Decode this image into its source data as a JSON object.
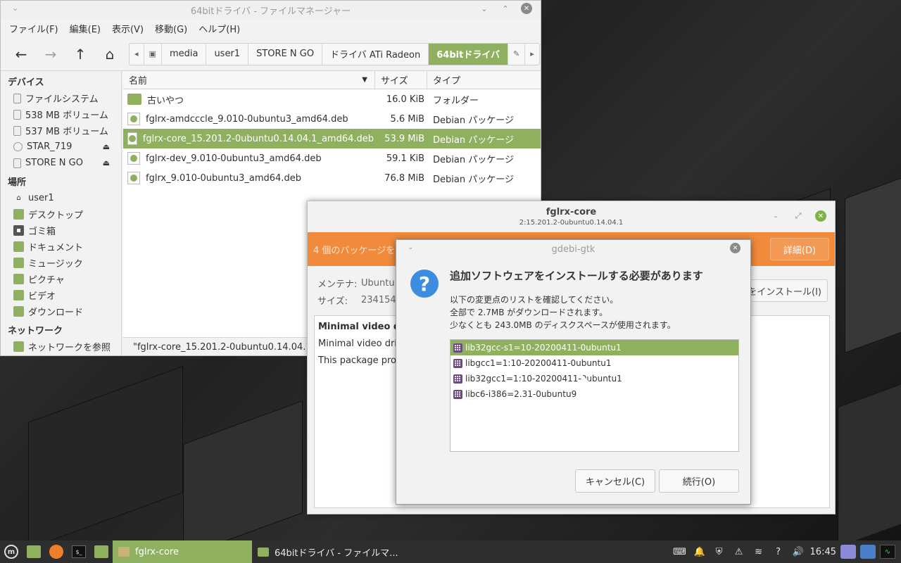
{
  "file_manager": {
    "title": "64bitドライバ - ファイルマネージャー",
    "menu": [
      "ファイル(F)",
      "編集(E)",
      "表示(V)",
      "移動(G)",
      "ヘルプ(H)"
    ],
    "path": [
      "media",
      "user1",
      "STORE N GO",
      "ドライバ ATi Radeon",
      "64bitドライバ"
    ],
    "sidebar": {
      "devices_header": "デバイス",
      "devices": [
        "ファイルシステム",
        "538 MB ボリューム",
        "537 MB ボリューム",
        "STAR_719",
        "STORE N GO"
      ],
      "places_header": "場所",
      "places": [
        "user1",
        "デスクトップ",
        "ゴミ箱",
        "ドキュメント",
        "ミュージック",
        "ピクチャ",
        "ビデオ",
        "ダウンロード"
      ],
      "network_header": "ネットワーク",
      "network": [
        "ネットワークを参照"
      ]
    },
    "columns": {
      "name": "名前",
      "size": "サイズ",
      "type": "タイプ"
    },
    "files": [
      {
        "name": "古いやつ",
        "size": "16.0 KiB",
        "type": "フォルダー",
        "kind": "folder"
      },
      {
        "name": "fglrx-amdcccle_9.010-0ubuntu3_amd64.deb",
        "size": "5.6 MiB",
        "type": "Debian パッケージ",
        "kind": "deb"
      },
      {
        "name": "fglrx-core_15.201.2-0ubuntu0.14.04.1_amd64.deb",
        "size": "53.9 MiB",
        "type": "Debian パッケージ",
        "kind": "deb"
      },
      {
        "name": "fglrx-dev_9.010-0ubuntu3_amd64.deb",
        "size": "59.1 KiB",
        "type": "Debian パッケージ",
        "kind": "deb"
      },
      {
        "name": "fglrx_9.010-0ubuntu3_amd64.deb",
        "size": "76.8 MiB",
        "type": "Debian パッケージ",
        "kind": "deb"
      }
    ],
    "status": "\"fglrx-core_15.201.2-0ubuntu0.14.04.1_"
  },
  "gdebi": {
    "title": "fglrx-core",
    "subtitle": "2:15.201.2-0ubuntu0.14.04.1",
    "banner": "4 個のパッケージを",
    "detail_button": "詳細(D)",
    "maintainer_label": "メンテナ:",
    "maintainer_value": "Ubuntu",
    "size_label": "サイズ:",
    "size_value": "234154",
    "install_button": "をインストール(I)",
    "desc_line1": "Minimal video driv",
    "desc_line2": "Minimal video drive",
    "desc_line3": "This package provi"
  },
  "dialog": {
    "title": "gdebi-gtk",
    "heading": "追加ソフトウェアをインストールする必要があります",
    "text1": "以下の変更点のリストを確認してください。",
    "text2": "全部で 2.7MB がダウンロードされます。",
    "text3": "少なくとも 243.0MB のディスクスペースが使用されます。",
    "packages": [
      "lib32gcc-s1=10-20200411-0ubuntu1",
      "libgcc1=1:10-20200411-0ubuntu1",
      "lib32gcc1=1:10-20200411-0ubuntu1",
      "libc6-i386=2.31-0ubuntu9"
    ],
    "cancel": "キャンセル(C)",
    "continue": "続行(O)"
  },
  "taskbar": {
    "task1": "fglrx-core",
    "task2": "64bitドライバ - ファイルマ...",
    "clock": "16:45"
  },
  "colors": {
    "accent": "#8fb15f",
    "banner": "#f18a3a",
    "question": "#3c8de0"
  }
}
